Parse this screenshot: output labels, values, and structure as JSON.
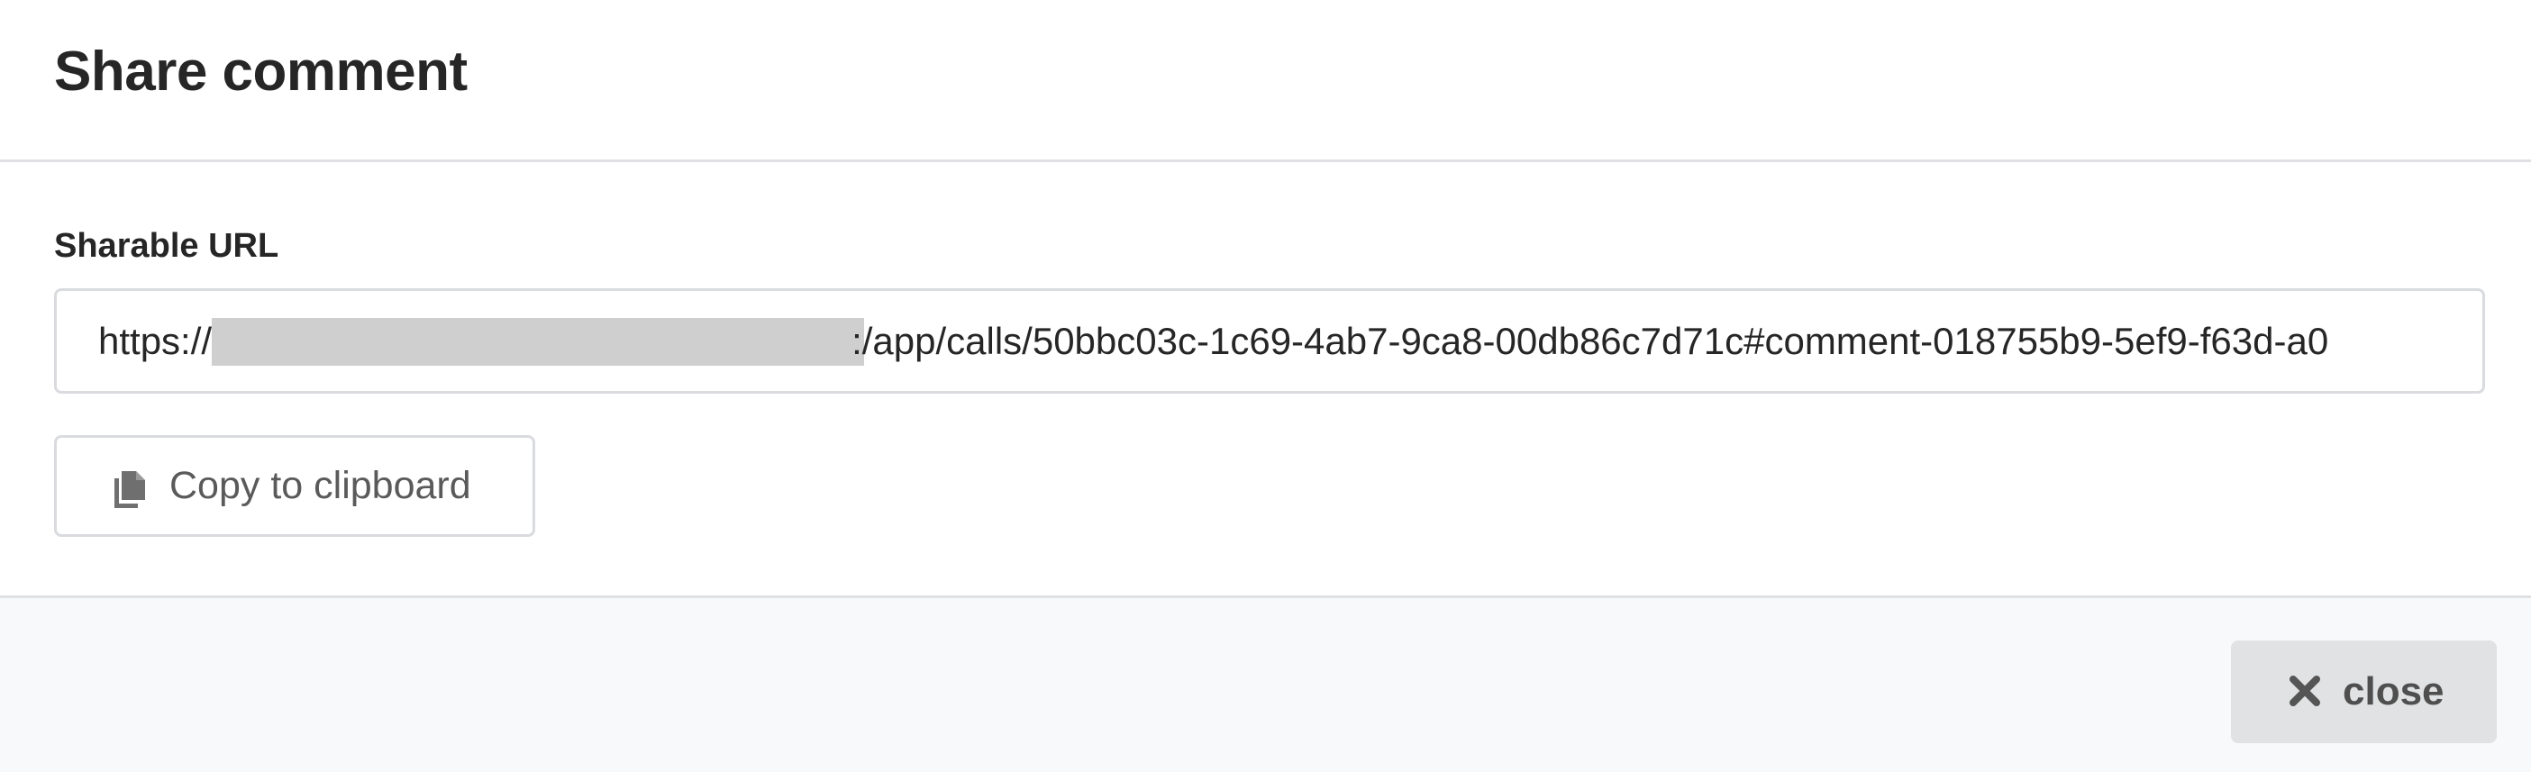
{
  "modal": {
    "title": "Share comment"
  },
  "share": {
    "label": "Sharable URL",
    "url_prefix": "https://",
    "url_rest": ":/app/calls/50bbc03c-1c69-4ab7-9ca8-00db86c7d71c#comment-018755b9-5ef9-f63d-a0",
    "copy_label": "Copy to clipboard",
    "copy_icon": "copy-icon"
  },
  "footer": {
    "close_label": "close",
    "close_icon": "times-icon"
  },
  "colors": {
    "redaction": "#cfcfd0",
    "footer_bg": "#f8f9fa",
    "close_button_bg": "#e1e2e3",
    "border": "#d9dbde"
  }
}
